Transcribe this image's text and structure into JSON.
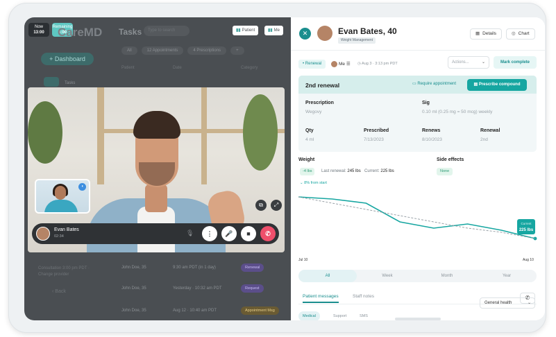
{
  "status_bar": {
    "time": "13:00",
    "time_label": "Now",
    "timer": "3:00",
    "timer_label": "Remaining"
  },
  "sidebar": {
    "logo": "CareMD",
    "dashboard_label": "Dashboard",
    "tasks_item": "Tasks",
    "note": "Consultation 3:00 pm PDT · Change provider",
    "back": "Back",
    "back2": ""
  },
  "tasks": {
    "title": "Tasks",
    "search_placeholder": "Type to search",
    "patient_btn": "Patient",
    "me_btn": "Me",
    "filters": [
      "All",
      "12 Appointments",
      "4 Prescriptions",
      "+"
    ],
    "col_patient": "Patient",
    "col_date": "Date",
    "col_category": "Category",
    "rows": [
      {
        "name": "John Doe, 35",
        "time": "9:30 am PDT (in 1 day)",
        "badge": "Renewal",
        "badge_color": "#7b5ce6"
      },
      {
        "name": "John Doe, 35",
        "time": "Yesterday · 10:32 am PDT",
        "badge": "Request",
        "badge_color": "#7b5ce6"
      },
      {
        "name": "John Doe, 35",
        "time": "Aug 12 · 10:40 am PDT",
        "badge": "Appointment Msg",
        "badge_color": "#c79a26"
      }
    ]
  },
  "call": {
    "caller_name": "Evan Bates",
    "caller_time": "02:34"
  },
  "patient": {
    "name": "Evan Bates, 40",
    "tag": "Weight Management",
    "details_btn": "Details",
    "chart_btn": "Chart",
    "renewal_chip": "Renewal",
    "assignee": "Me",
    "appointment": "Aug 3 · 3:13 pm PDT",
    "actions_placeholder": "Actions...",
    "mark_complete": "Mark complete"
  },
  "renewal_card": {
    "title": "2nd renewal",
    "require_appt": "Require appointment",
    "prescribe": "Prescribe compound",
    "prescription_label": "Prescription",
    "prescription_value": "Wegovy",
    "sig_label": "Sig",
    "sig_value": "0.10 ml (0.25 mg = 50 mcg) weekly",
    "qty_label": "Qty",
    "qty_value": "4 ml",
    "prescribed_label": "Prescribed",
    "prescribed_value": "7/13/2023",
    "renews_label": "Renews",
    "renews_value": "8/10/2023",
    "renewal_label": "Renewal",
    "renewal_value": "2nd"
  },
  "weight": {
    "label": "Weight",
    "change": "-4 lbs",
    "last_renewal_label": "Last renewal:",
    "last_renewal_value": "245 lbs",
    "current_label": "Current:",
    "current_value": "225 lbs",
    "trend": "8% from start"
  },
  "side_effects": {
    "label": "Side effects",
    "value": "None"
  },
  "chart_data": {
    "type": "line",
    "x": [
      "Jul 10",
      "",
      "",
      "",
      "",
      "",
      "",
      "Aug 10"
    ],
    "series": [
      {
        "values": [
          245,
          244,
          242,
          233,
          230,
          232,
          229,
          225
        ]
      },
      {
        "values": [
          245,
          242,
          239,
          236,
          233,
          230,
          228,
          225
        ]
      }
    ],
    "xlabel": "",
    "ylabel": "",
    "callout_label": "Current",
    "callout_value": "225 lbs",
    "colors": {
      "line": "#16a6a1",
      "trend": "#9aa2a8"
    }
  },
  "ranges": [
    "All",
    "Week",
    "Month",
    "Year"
  ],
  "messages": {
    "tab1": "Patient messages",
    "tab2": "Staff notes",
    "sub1": "Medical",
    "sub2": "Support",
    "sub3": "SMS",
    "filter": "General health"
  }
}
